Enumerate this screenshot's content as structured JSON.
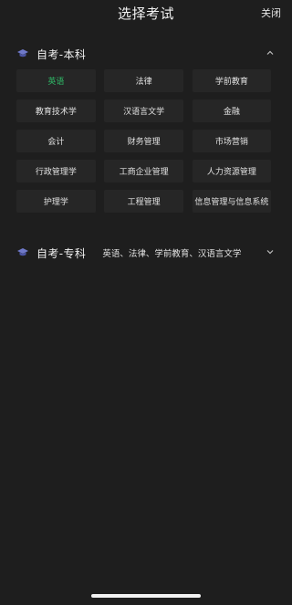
{
  "header": {
    "title": "选择考试",
    "close_label": "关闭"
  },
  "sections": [
    {
      "title": "自考-本科",
      "expanded": true,
      "chevron": "chevron-up-icon",
      "options": [
        {
          "label": "英语",
          "selected": true
        },
        {
          "label": "法律",
          "selected": false
        },
        {
          "label": "学前教育",
          "selected": false
        },
        {
          "label": "教育技术学",
          "selected": false
        },
        {
          "label": "汉语言文学",
          "selected": false
        },
        {
          "label": "金融",
          "selected": false
        },
        {
          "label": "会计",
          "selected": false
        },
        {
          "label": "财务管理",
          "selected": false
        },
        {
          "label": "市场营销",
          "selected": false
        },
        {
          "label": "行政管理学",
          "selected": false
        },
        {
          "label": "工商企业管理",
          "selected": false
        },
        {
          "label": "人力资源管理",
          "selected": false
        },
        {
          "label": "护理学",
          "selected": false
        },
        {
          "label": "工程管理",
          "selected": false
        },
        {
          "label": "信息管理与信息系统",
          "selected": false
        }
      ]
    },
    {
      "title": "自考-专科",
      "expanded": false,
      "chevron": "chevron-down-icon",
      "summary": "英语、法律、学前教育、汉语言文学"
    }
  ],
  "colors": {
    "background": "#1e1e1e",
    "cell": "#262626",
    "selected": "#2fb766",
    "icon": "#6f79c9"
  }
}
